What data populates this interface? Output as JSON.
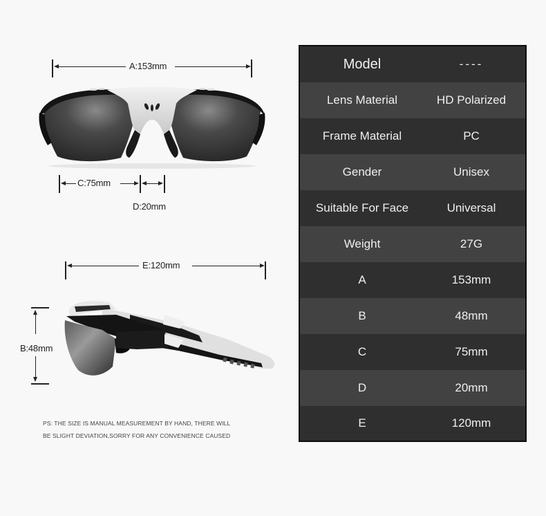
{
  "colors": {
    "background": "#f8f8f8",
    "table_dark_row": "#2f2f2f",
    "table_light_row": "#424242",
    "table_border": "#0d0d0d",
    "table_text": "#efefef",
    "annotation": "#222222"
  },
  "front_view": {
    "dim_a_label": "A:153mm",
    "dim_c_label": "C:75mm",
    "dim_d_label": "D:20mm"
  },
  "side_view": {
    "dim_e_label": "E:120mm",
    "dim_b_label": "B:48mm"
  },
  "note": {
    "line1": "PS: THE SIZE IS MANUAL MEASUREMENT BY HAND, THERE WILL",
    "line2": "BE SLIGHT DEVIATION,SORRY FOR ANY CONVENIENCE CAUSED"
  },
  "specs": [
    {
      "label": "Model",
      "value": "----"
    },
    {
      "label": "Lens Material",
      "value": "HD Polarized"
    },
    {
      "label": "Frame Material",
      "value": "PC"
    },
    {
      "label": "Gender",
      "value": "Unisex"
    },
    {
      "label": "Suitable For Face",
      "value": "Universal"
    },
    {
      "label": "Weight",
      "value": "27G"
    },
    {
      "label": "A",
      "value": "153mm"
    },
    {
      "label": "B",
      "value": "48mm"
    },
    {
      "label": "C",
      "value": "75mm"
    },
    {
      "label": "D",
      "value": "20mm"
    },
    {
      "label": "E",
      "value": "120mm"
    }
  ]
}
